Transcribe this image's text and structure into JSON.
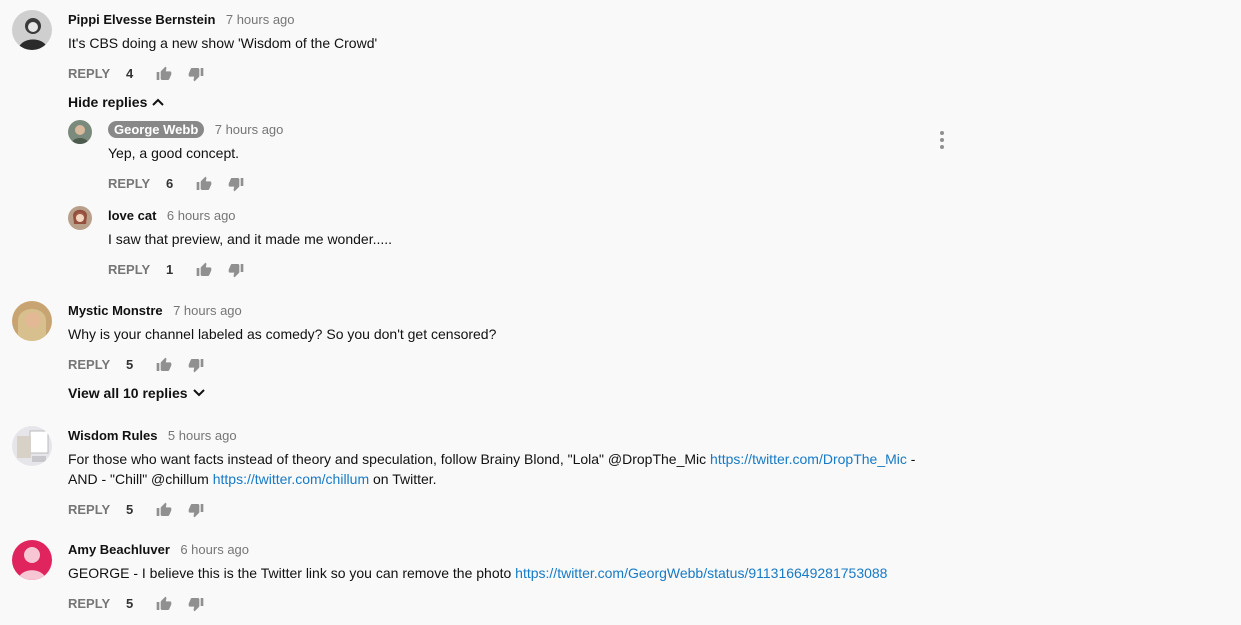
{
  "comments": [
    {
      "author": "Pippi Elvesse Bernstein",
      "time": "7 hours ago",
      "text": "It's CBS doing a new show 'Wisdom of the Crowd'",
      "reply_label": "REPLY",
      "likes": "4",
      "toggle": "Hide replies",
      "replies": [
        {
          "author": "George Webb",
          "time": "7 hours ago",
          "text": "Yep, a good concept.",
          "reply_label": "REPLY",
          "likes": "6"
        },
        {
          "author": "love cat",
          "time": "6 hours ago",
          "text": "I saw that preview, and it made me wonder.....",
          "reply_label": "REPLY",
          "likes": "1"
        }
      ]
    },
    {
      "author": "Mystic Monstre",
      "time": "7 hours ago",
      "text": "Why is your channel labeled as comedy? So you don't get censored?",
      "reply_label": "REPLY",
      "likes": "5",
      "toggle": "View all 10 replies"
    },
    {
      "author": "Wisdom Rules",
      "time": "5 hours ago",
      "text_part1": "For those who want facts instead of theory and speculation, follow Brainy Blond, \"Lola\" @DropThe_Mic ",
      "link1": "https://twitter.com/DropThe_Mic",
      "text_part2": " - AND - \"Chill\"  @chillum ",
      "link2": "https://twitter.com/chillum",
      "text_part3": " on Twitter.",
      "reply_label": "REPLY",
      "likes": "5"
    },
    {
      "author": "Amy Beachluver",
      "time": "6 hours ago",
      "text_part1": "GEORGE - I believe this is the Twitter link so you can remove the photo ",
      "link1": "https://twitter.com/GeorgWebb/status/911316649281753088",
      "reply_label": "REPLY",
      "likes": "5"
    }
  ],
  "colors": {
    "link": "#167ac6",
    "secondary_text": "#767676",
    "badge": "#888888",
    "amy_avatar": "#e0245e"
  },
  "icons": [
    "thumbs-up-icon",
    "thumbs-down-icon",
    "chevron-up-icon",
    "chevron-down-icon",
    "more-vert-icon"
  ]
}
